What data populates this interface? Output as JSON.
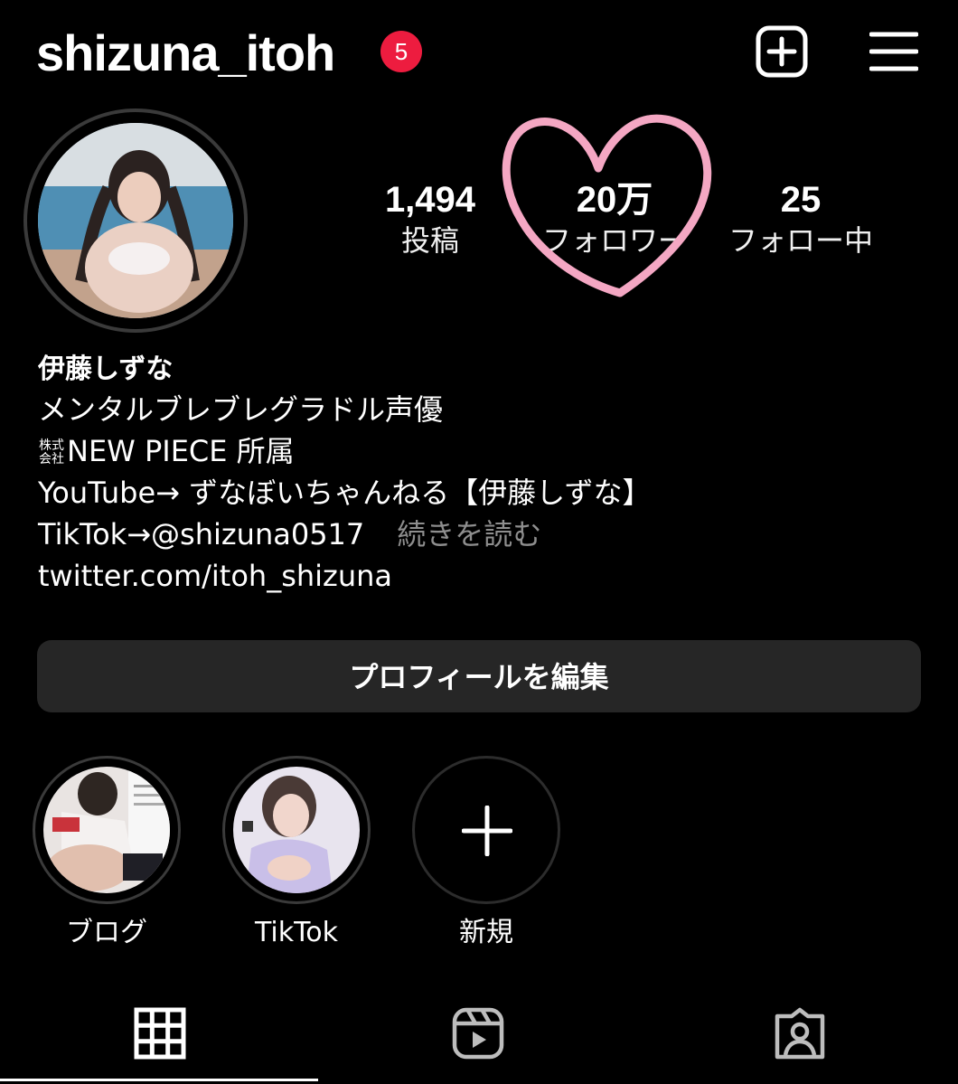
{
  "header": {
    "username": "shizuna_itoh",
    "notification_count": "5",
    "icons": [
      "plus-square-icon",
      "menu-icon"
    ]
  },
  "stats": [
    {
      "value": "1,494",
      "label": "投稿"
    },
    {
      "value": "20万",
      "label": "フォロワー"
    },
    {
      "value": "25",
      "label": "フォロー中"
    }
  ],
  "bio": {
    "name": "伊藤しずな",
    "line1": "メンタルブレブレグラドル声優",
    "kabushiki_top": "株式",
    "kabushiki_bottom": "会社",
    "line2": "NEW PIECE 所属",
    "line3": "YouTube→ ずなぼいちゃんねる【伊藤しずな】",
    "line4": "TikTok→@shizuna0517",
    "more": "続きを読む",
    "link": "twitter.com/itoh_shizuna"
  },
  "edit_profile_label": "プロフィールを編集",
  "highlights": [
    {
      "label": "ブログ"
    },
    {
      "label": "TikTok"
    },
    {
      "label": "新規"
    }
  ],
  "tabs": [
    "grid-icon",
    "reels-icon",
    "tagged-icon"
  ],
  "colors": {
    "background": "#000000",
    "badge": "#ed1c3f",
    "button": "#262626",
    "heart": "#f4a7c3",
    "muted": "#8e8e8e"
  }
}
